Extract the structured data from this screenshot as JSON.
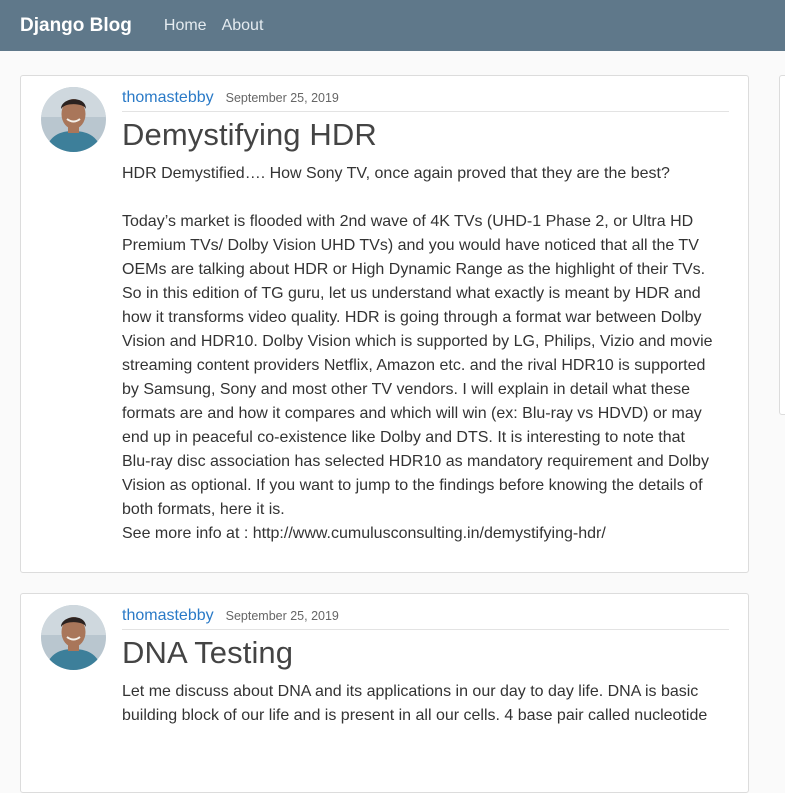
{
  "nav": {
    "brand": "Django Blog",
    "links": [
      "Home",
      "About"
    ]
  },
  "posts": [
    {
      "author": "thomastebby",
      "date": "September 25, 2019",
      "title": "Demystifying HDR",
      "intro": "HDR Demystified…. How Sony TV, once again proved that they are the best?",
      "lines": [
        "Today’s market is flooded with 2nd wave of 4K TVs (UHD-1 Phase 2, or Ultra HD",
        "Premium TVs/ Dolby Vision UHD TVs) and you would have noticed that all the TV",
        "OEMs are talking about HDR or High Dynamic Range as the highlight of their TVs.",
        "So in this edition of TG guru, let us understand what exactly is meant by HDR and",
        "how it transforms video quality. HDR is going through a format war between Dolby",
        "Vision and HDR10. Dolby Vision which is supported by LG, Philips, Vizio and movie",
        "streaming content providers Netflix, Amazon etc. and the rival HDR10 is supported",
        "by Samsung, Sony and most other TV vendors. I will explain in detail what these",
        "formats are and how it compares and which will win (ex: Blu-ray vs HDVD) or may",
        "end up in peaceful co-existence like Dolby and DTS. It is interesting to note that",
        "Blu-ray disc association has selected HDR10 as mandatory requirement and Dolby",
        "Vision as optional. If you want to jump to the findings before knowing the details of",
        "both formats, here it is."
      ],
      "more": "See more info at : http://www.cumulusconsulting.in/demystifying-hdr/"
    },
    {
      "author": "thomastebby",
      "date": "September 25, 2019",
      "title": "DNA Testing",
      "lines": [
        "Let me discuss about DNA and its applications in our day to day life. DNA is basic",
        "building block of our life and is present in all our cells. 4 base pair called nucleotide"
      ]
    }
  ]
}
